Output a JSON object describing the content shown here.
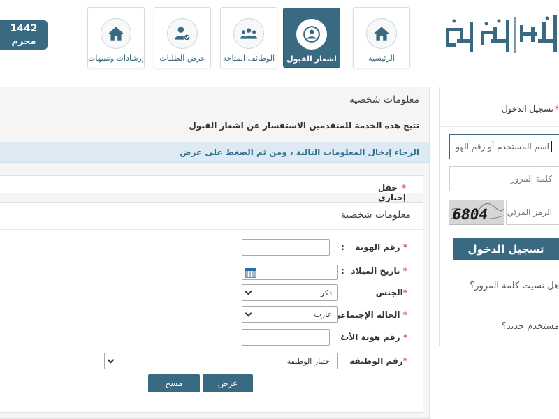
{
  "header": {
    "logo_text": "أبشر توظيف",
    "date": {
      "year": "1442",
      "month": "محرم"
    },
    "nav": [
      {
        "label": "الرئيسية",
        "icon": "home-icon"
      },
      {
        "label": "اشعار القبول",
        "icon": "acceptance-icon",
        "active": true
      },
      {
        "label": "الوظائف المتاحة",
        "icon": "group-icon"
      },
      {
        "label": "عرض الطلبات",
        "icon": "user-check-icon"
      },
      {
        "label": "إرشادات وتنبيهات",
        "icon": "home-icon"
      }
    ]
  },
  "main": {
    "title": "معلومات شخصية",
    "description": "تتيح هذه الخدمة للمتقدمين الاستفسار عن اشعار القبول",
    "info": "الرجاء إدخال المعلومات التالية ، ومن ثم الضغط على عرض",
    "required_note": "حقل إجباري",
    "form_title": "معلومات شخصية",
    "fields": {
      "id_number": {
        "label": "رقم الهوية",
        "value": ""
      },
      "birth_date": {
        "label": "تاريخ الميلاد",
        "value": ""
      },
      "gender": {
        "label": "الجنس",
        "value": "ذكر"
      },
      "marital_status": {
        "label": "الحالة الإجتماعية",
        "value": "عازب"
      },
      "father_id": {
        "label": "رقم هوية الأب",
        "value": ""
      },
      "job_number": {
        "label": "رقم الوظيفة",
        "value": "اختيار الوظيفة"
      }
    },
    "buttons": {
      "submit": "عرض",
      "clear": "مسح"
    }
  },
  "login": {
    "title": "تسجيل الدخول",
    "username_placeholder": "اسم المستخدم أو رقم الهو",
    "password_placeholder": "كلمة المرور",
    "captcha_label": "الرمز المرئي",
    "captcha_text": "6804",
    "login_button": "تسجيل الدخول",
    "forgot_password": "هل نسيت كلمة المرور؟",
    "new_user": "مستخدم جديد؟"
  },
  "colors": {
    "brand": "#3a6a82",
    "required": "#d9534f",
    "info_bg": "#dde9f3"
  }
}
